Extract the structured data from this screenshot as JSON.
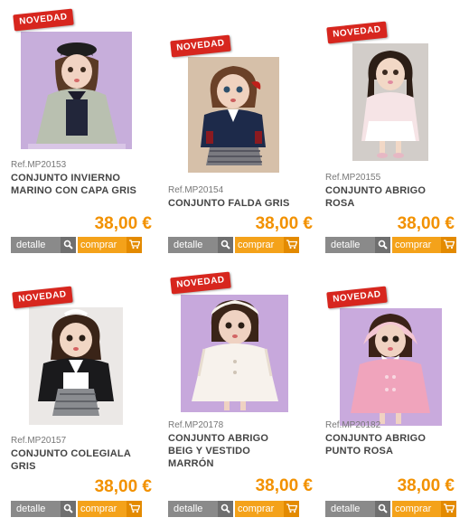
{
  "colors": {
    "badge": "#d7261e",
    "price": "#f29100",
    "detalle_button": "#8a8a8a",
    "comprar_button": "#f4a21a"
  },
  "products": [
    {
      "badge": "NOVEDAD",
      "ref": "Ref.MP20153",
      "name": "CONJUNTO INVIERNO MARINO CON CAPA GRIS",
      "price": "38,00 €",
      "detalle": "detalle",
      "comprar": "comprar",
      "detalle_icon": "magnifier-icon",
      "comprar_icon": "cart-icon"
    },
    {
      "badge": "NOVEDAD",
      "ref": "Ref.MP20154",
      "name": "CONJUNTO FALDA GRIS",
      "price": "38,00 €",
      "detalle": "detalle",
      "comprar": "comprar",
      "detalle_icon": "magnifier-icon",
      "comprar_icon": "cart-icon"
    },
    {
      "badge": "NOVEDAD",
      "ref": "Ref.MP20155",
      "name": "CONJUNTO ABRIGO ROSA",
      "price": "38,00 €",
      "detalle": "detalle",
      "comprar": "comprar",
      "detalle_icon": "magnifier-icon",
      "comprar_icon": "cart-icon"
    },
    {
      "badge": "NOVEDAD",
      "ref": "Ref.MP20157",
      "name": "CONJUNTO COLEGIALA GRIS",
      "price": "38,00 €",
      "detalle": "detalle",
      "comprar": "comprar",
      "detalle_icon": "magnifier-icon",
      "comprar_icon": "cart-icon"
    },
    {
      "badge": "NOVEDAD",
      "ref": "Ref.MP20178",
      "name": "CONJUNTO ABRIGO BEIG Y VESTIDO MARRÓN",
      "price": "38,00 €",
      "detalle": "detalle",
      "comprar": "comprar",
      "detalle_icon": "magnifier-icon",
      "comprar_icon": "cart-icon"
    },
    {
      "badge": "NOVEDAD",
      "ref": "Ref.MP20182",
      "name": "CONJUNTO ABRIGO PUNTO ROSA",
      "price": "38,00 €",
      "detalle": "detalle",
      "comprar": "comprar",
      "detalle_icon": "magnifier-icon",
      "comprar_icon": "cart-icon"
    }
  ]
}
